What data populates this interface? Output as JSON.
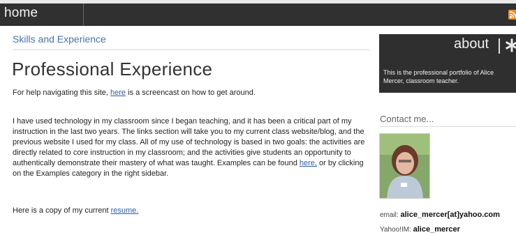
{
  "topbar": {
    "home_label": "home",
    "rss_icon": "rss-feed-icon",
    "rss_color": "#f08a1d"
  },
  "breadcrumb": {
    "label": "Skills and Experience"
  },
  "page": {
    "title": "Professional Experience",
    "para1": {
      "before": "For help navigating this site, ",
      "link": "here",
      "after": " is a screencast on how to get around."
    },
    "para2": {
      "before": "I have used technology in my classroom since I began teaching, and it has been a critical part of my instruction in the last two years.  The links section will take you to my current class website/blog, and the previous website I used for my class.  All of my use of technology is based in two goals: the activities are directly related to core instruction in my classroom; and the activities give students an opportunity to authentically demonstrate their mastery of what was taught.  Examples can be found ",
      "link": "here,",
      "after": " or by clicking on the Examples category in the right sidebar."
    },
    "para3": {
      "before": "Here is a copy of my current ",
      "link": "resume.",
      "after": ""
    },
    "link_color": "#2e5fa3"
  },
  "sidebar": {
    "about": {
      "title": "about",
      "icon": "star-icon",
      "text": "This is the professional portfolio of Alice Mercer, classroom teacher."
    },
    "contact": {
      "title": "Contact me...",
      "email_label": "email:",
      "email_value": "alice_mercer[at]yahoo.com",
      "im_label": "Yahoo!IM:",
      "im_value": "alice_mercer"
    }
  }
}
